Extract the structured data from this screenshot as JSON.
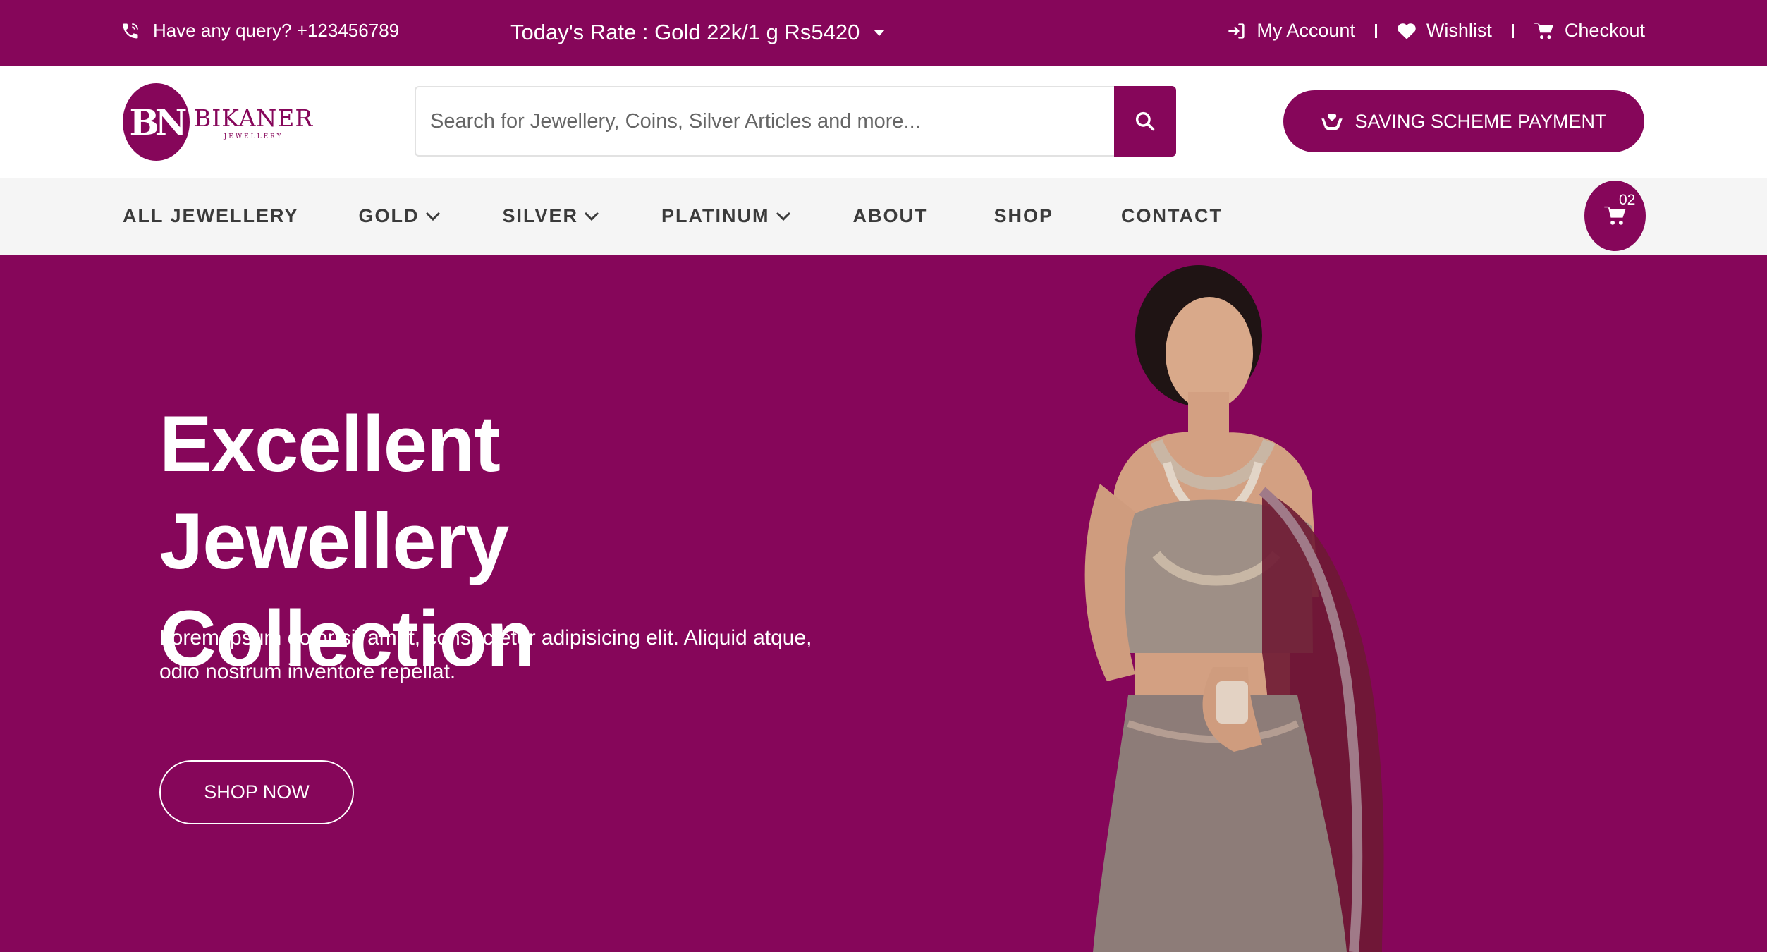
{
  "topbar": {
    "query_text": "Have any query? +123456789",
    "query_icon": "phone-icon",
    "rate_text": "Today's Rate : Gold 22k/1 g Rs5420",
    "links": [
      {
        "label": "My Account",
        "icon": "login-icon"
      },
      {
        "label": "Wishlist",
        "icon": "heart-icon"
      },
      {
        "label": "Checkout",
        "icon": "cart-icon"
      }
    ]
  },
  "header": {
    "logo_initials": "BN",
    "logo_name": "BIKANER",
    "logo_sub": "JEWELLERY",
    "search_placeholder": "Search for Jewellery, Coins, Silver Articles and more...",
    "saving_scheme_label": "SAVING SCHEME PAYMENT"
  },
  "nav": {
    "items": [
      {
        "label": "ALL JEWELLERY",
        "dropdown": false
      },
      {
        "label": "GOLD",
        "dropdown": true
      },
      {
        "label": "SILVER",
        "dropdown": true
      },
      {
        "label": "PLATINUM",
        "dropdown": true
      },
      {
        "label": "ABOUT",
        "dropdown": false
      },
      {
        "label": "SHOP",
        "dropdown": false
      },
      {
        "label": "CONTACT",
        "dropdown": false
      }
    ],
    "cart_count": "02"
  },
  "hero": {
    "title_line1": "Excellent Jewellery",
    "title_line2": "Collection",
    "description": "Lorem ipsum dolor sit amet, consectetur adipisicing elit. Aliquid atque, odio nostrum inventore repellat.",
    "cta_label": "SHOP NOW"
  },
  "colors": {
    "brand": "#86065a",
    "nav_bg": "#f5f5f5",
    "nav_text": "#3b3b3b"
  }
}
